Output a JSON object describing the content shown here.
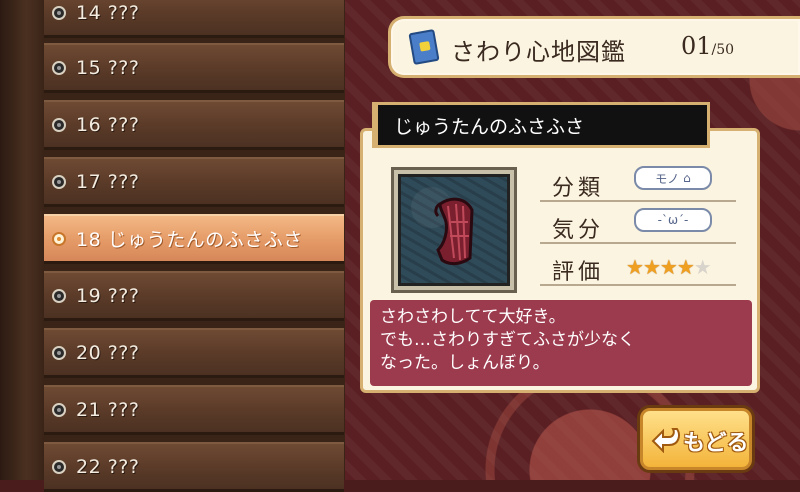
{
  "title": {
    "label": "さわり心地図鑑",
    "count": "01",
    "total": "/50"
  },
  "list": {
    "items": [
      {
        "label": "14 ???"
      },
      {
        "label": "15 ???"
      },
      {
        "label": "16 ???"
      },
      {
        "label": "17 ???"
      },
      {
        "label": "18 じゅうたんのふさふさ",
        "selected": true
      },
      {
        "label": "19 ???"
      },
      {
        "label": "20 ???"
      },
      {
        "label": "21 ???"
      },
      {
        "label": "22 ???"
      }
    ]
  },
  "detail": {
    "name": "じゅうたんのふさふさ",
    "category_label": "分類",
    "category_value": "モノ",
    "mood_label": "気分",
    "mood_value": "-`ω´-",
    "rating_label": "評価",
    "rating": 4,
    "rating_max": 5,
    "description": [
      "さわさわしてて大好き。",
      "でも…さわりすぎてふさが少なく",
      "なった。しょんぼり。"
    ],
    "icon": "carpet-fringe-icon"
  },
  "back_button": {
    "label": "もどる",
    "icon": "return-arrow-icon"
  },
  "colors": {
    "selected_row": "#e49a66",
    "description_bg": "#9c3a4e",
    "star_on": "#f0a020"
  }
}
